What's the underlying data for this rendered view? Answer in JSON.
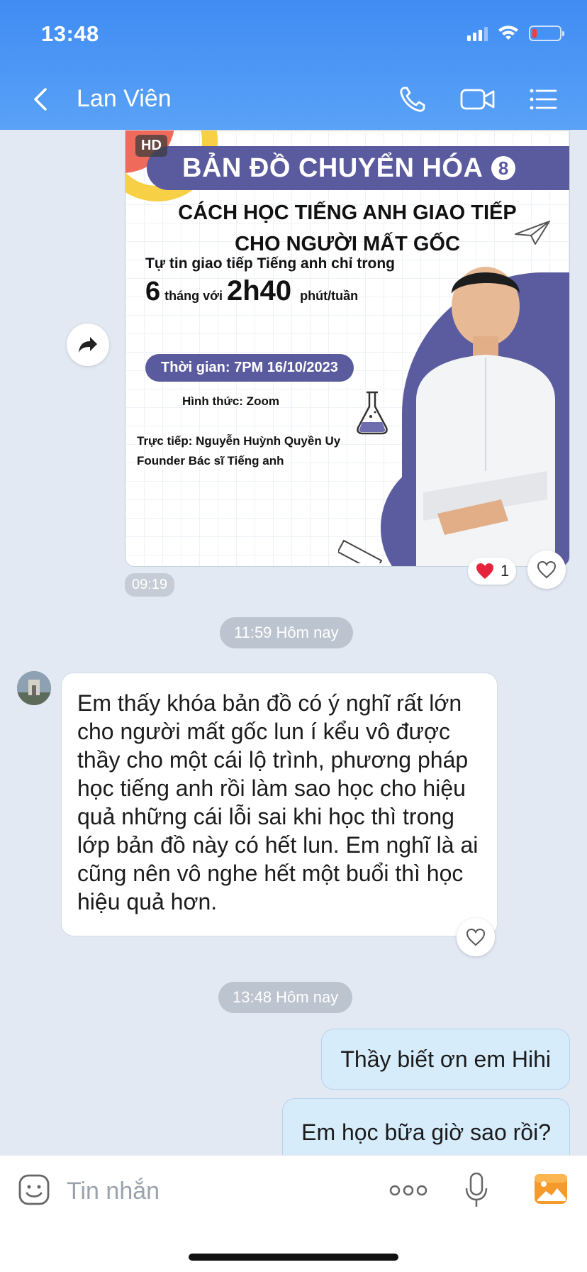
{
  "status_bar": {
    "time": "13:48"
  },
  "header": {
    "contact_name": "Lan Viên"
  },
  "image_message": {
    "hd_badge": "HD",
    "title": "BẢN ĐỒ CHUYỂN HÓA",
    "title_number": "8",
    "subtitle_line1": "CÁCH HỌC TIẾNG ANH GIAO TIẾP",
    "subtitle_line2": "CHO NGƯỜI MẤT GỐC",
    "tagline_line1": "Tự tin giao tiếp Tiếng anh chỉ trong",
    "tagline_6": "6",
    "tagline_thang_voi": "tháng với",
    "tagline_2h40": "2h40",
    "tagline_phut_tuan": "phút/tuần",
    "time_pill": "Thời gian: 7PM 16/10/2023",
    "format": "Hình thức: Zoom",
    "presenter_line1": "Trực tiếp: Nguyễn Huỳnh Quyền Uy",
    "presenter_line2": "Founder Bác sĩ Tiếng anh",
    "reaction_count": "1",
    "sent_time": "09:19"
  },
  "dividers": [
    "11:59 Hôm nay",
    "13:48 Hôm nay"
  ],
  "incoming_message": {
    "text": "Em thấy khóa bản đồ có ý nghĩ rất lớn cho người mất gốc lun í kểu vô được thầy cho một cái lộ trình, phương pháp học tiếng anh rồi làm sao học cho hiệu quả những cái lỗi sai khi học thì trong lớp bản đồ này có hết lun. Em nghĩ là ai cũng nên vô nghe hết một buổi thì học hiệu quả hơn."
  },
  "outgoing_messages": [
    "Thầy biết ơn em Hihi",
    "Em học bữa giờ sao rồi?"
  ],
  "input_bar": {
    "placeholder": "Tin nhắn"
  },
  "colors": {
    "header": "#4a93f5",
    "chat_bg": "#e2e9f3",
    "outgoing_bubble": "#d6ecfb",
    "poster_purple": "#5a5a9e"
  }
}
